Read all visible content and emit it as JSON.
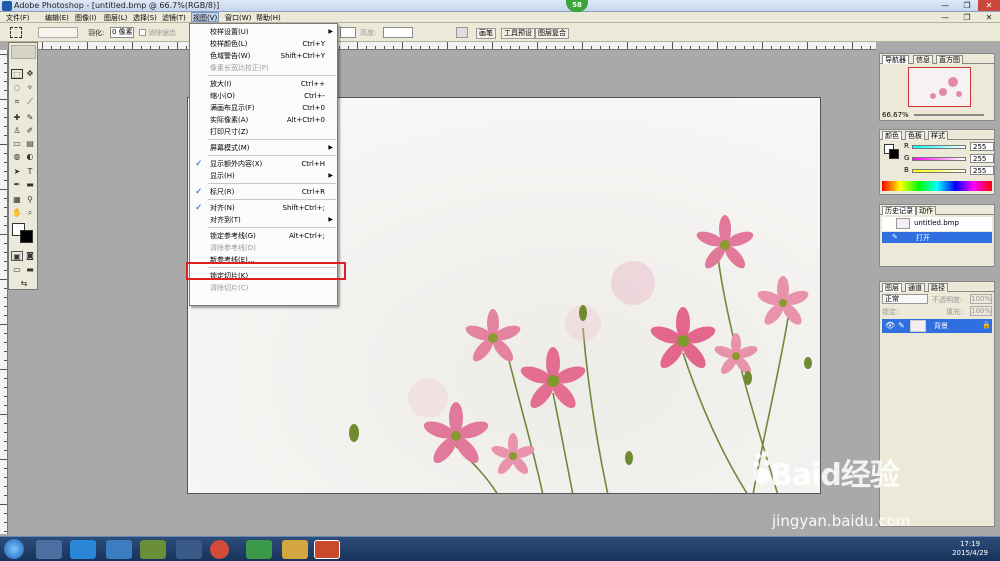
{
  "window": {
    "title": "Adobe Photoshop - [untitled.bmp @ 66.7%(RGB/8)]",
    "badge": "58"
  },
  "menubar": [
    {
      "label": "文件(F)"
    },
    {
      "label": "编辑(E)"
    },
    {
      "label": "图像(I)"
    },
    {
      "label": "图层(L)"
    },
    {
      "label": "选择(S)"
    },
    {
      "label": "滤镜(T)"
    },
    {
      "label": "视图(V)"
    },
    {
      "label": "窗口(W)"
    },
    {
      "label": "帮助(H)"
    }
  ],
  "options_bar": {
    "feather_label": "羽化:",
    "feather_value": "0 像素",
    "antialias_label": "消除锯齿",
    "height_label": "高度:",
    "tabs": [
      "画笔",
      "工具预设",
      "图层复合"
    ]
  },
  "view_menu": {
    "items": [
      {
        "label": "校样设置(U)",
        "shortcut": "",
        "submenu": true,
        "disabled": false,
        "checked": false
      },
      {
        "label": "校样颜色(L)",
        "shortcut": "Ctrl+Y",
        "submenu": false,
        "disabled": false,
        "checked": false
      },
      {
        "label": "色域警告(W)",
        "shortcut": "Shift+Ctrl+Y",
        "submenu": false,
        "disabled": false,
        "checked": false
      },
      {
        "label": "像素长宽比校正(P)",
        "shortcut": "",
        "submenu": false,
        "disabled": true,
        "checked": false
      },
      {
        "sep": true
      },
      {
        "label": "放大(I)",
        "shortcut": "Ctrl++",
        "submenu": false,
        "disabled": false,
        "checked": false
      },
      {
        "label": "缩小(O)",
        "shortcut": "Ctrl+-",
        "submenu": false,
        "disabled": false,
        "checked": false
      },
      {
        "label": "满画布显示(F)",
        "shortcut": "Ctrl+0",
        "submenu": false,
        "disabled": false,
        "checked": false
      },
      {
        "label": "实际像素(A)",
        "shortcut": "Alt+Ctrl+0",
        "submenu": false,
        "disabled": false,
        "checked": false
      },
      {
        "label": "打印尺寸(Z)",
        "shortcut": "",
        "submenu": false,
        "disabled": false,
        "checked": false
      },
      {
        "sep": true
      },
      {
        "label": "屏幕模式(M)",
        "shortcut": "",
        "submenu": true,
        "disabled": false,
        "checked": false
      },
      {
        "sep": true
      },
      {
        "label": "显示额外内容(X)",
        "shortcut": "Ctrl+H",
        "submenu": false,
        "disabled": false,
        "checked": true
      },
      {
        "label": "显示(H)",
        "shortcut": "",
        "submenu": true,
        "disabled": false,
        "checked": false
      },
      {
        "sep": true
      },
      {
        "label": "标尺(R)",
        "shortcut": "Ctrl+R",
        "submenu": false,
        "disabled": false,
        "checked": true
      },
      {
        "sep": true
      },
      {
        "label": "对齐(N)",
        "shortcut": "Shift+Ctrl+;",
        "submenu": false,
        "disabled": false,
        "checked": true
      },
      {
        "label": "对齐到(T)",
        "shortcut": "",
        "submenu": true,
        "disabled": false,
        "checked": false
      },
      {
        "sep": true
      },
      {
        "label": "锁定参考线(G)",
        "shortcut": "Alt+Ctrl+;",
        "submenu": false,
        "disabled": false,
        "checked": false
      },
      {
        "label": "清除参考线(D)",
        "shortcut": "",
        "submenu": false,
        "disabled": true,
        "checked": false
      },
      {
        "label": "新参考线(E)...",
        "shortcut": "",
        "submenu": false,
        "disabled": false,
        "checked": false,
        "highlight": true
      },
      {
        "sep": true
      },
      {
        "label": "锁定切片(K)",
        "shortcut": "",
        "submenu": false,
        "disabled": false,
        "checked": false
      },
      {
        "label": "清除切片(C)",
        "shortcut": "",
        "submenu": false,
        "disabled": true,
        "checked": false
      }
    ]
  },
  "navigator": {
    "tabs": [
      "导航器",
      "信息",
      "直方图"
    ],
    "zoom": "66.67%"
  },
  "color_panel": {
    "tabs": [
      "颜色",
      "色板",
      "样式"
    ],
    "channels": [
      {
        "label": "R",
        "value": "255",
        "color": "#e04040"
      },
      {
        "label": "G",
        "value": "255",
        "color": "#40b040"
      },
      {
        "label": "B",
        "value": "255",
        "color": "#4060e0"
      }
    ]
  },
  "history_panel": {
    "tabs": [
      "历史记录",
      "动作"
    ],
    "document": "untitled.bmp",
    "state": "打开"
  },
  "layers_panel": {
    "tabs": [
      "图层",
      "通道",
      "路径"
    ],
    "blend_mode": "正常",
    "opacity_label": "不透明度:",
    "opacity": "100%",
    "lock_label": "锁定:",
    "fill_label": "填充:",
    "fill": "100%",
    "layer_name": "背景"
  },
  "taskbar": {
    "time": "17:19",
    "date": "2015/4/29"
  },
  "watermark": {
    "brand": "Baid经验",
    "url": "jingyan.baidu.com"
  }
}
